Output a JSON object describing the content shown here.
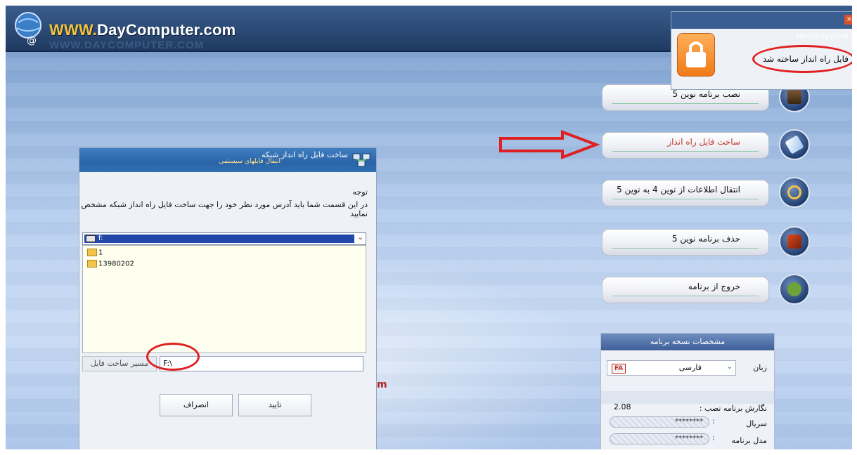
{
  "header": {
    "brand_www": "WWW.",
    "brand_site": "DayComputer.com",
    "brand_shadow": "WWW.DAYCOMPUTER.COM"
  },
  "notification": {
    "system": "Novin system",
    "message": "فایل راه انداز ساخته شد",
    "close_label": "×"
  },
  "menu": [
    {
      "label": "نصب برنامه نوین 5",
      "icon": "monitor-icon"
    },
    {
      "label": "ساخت فایل راه انداز",
      "icon": "pen-icon"
    },
    {
      "label": "انتقال اطلاعات از نوین 4 به نوین 5",
      "icon": "gear-icon"
    },
    {
      "label": "حذف برنامه نوین 5",
      "icon": "delete-icon"
    },
    {
      "label": "خروج از برنامه",
      "icon": "exit-icon"
    }
  ],
  "info_panel": {
    "title": "مشخصات نسخه برنامه",
    "language_label": "زبان",
    "language_value": "فارسی",
    "flag_text": "FA",
    "version_label": "نگارش برنامه نصب :",
    "version_value": "2.08",
    "serial_label": "سریال",
    "serial_value": "********",
    "model_label": "مدل برنامه",
    "model_value": "********",
    "colon": ":"
  },
  "dialog": {
    "title": "ساخت فایل راه انداز شبکه",
    "subtitle": "انتقال فایلهای سیستمی",
    "note_heading": "توجه",
    "note_body": "در این قسمت شما باید آدرس مورد نظر خود را جهت ساخت فایل راه انداز شبکه  مشخص نمایید",
    "drive_value": "f:",
    "folders": [
      "1",
      "13980202"
    ],
    "path_label": "مسیر ساخت فایل",
    "path_value": "F:\\",
    "ok_label": "تایید",
    "cancel_label": "انصراف"
  },
  "colors": {
    "accent_red": "#e02020",
    "title_blue": "#2a65a8"
  },
  "stray_mark": "m"
}
